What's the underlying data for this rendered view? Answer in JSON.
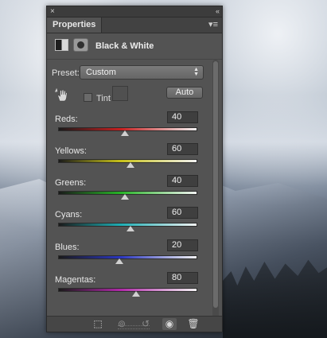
{
  "panel": {
    "title": "Properties",
    "close_glyph": "×",
    "collapse_glyph": "«",
    "menu_glyph": "▾≡",
    "header_title": "Black & White"
  },
  "preset": {
    "label": "Preset:",
    "value": "Custom",
    "arrows": "▲▼"
  },
  "tint": {
    "label": "Tint",
    "checked": false
  },
  "auto_label": "Auto",
  "sliders": [
    {
      "label": "Reds:",
      "value": "40",
      "min": -200,
      "max": 300,
      "position": 40
    },
    {
      "label": "Yellows:",
      "value": "60",
      "min": -200,
      "max": 300,
      "position": 60
    },
    {
      "label": "Greens:",
      "value": "40",
      "min": -200,
      "max": 300,
      "position": 40
    },
    {
      "label": "Cyans:",
      "value": "60",
      "min": -200,
      "max": 300,
      "position": 60
    },
    {
      "label": "Blues:",
      "value": "20",
      "min": -200,
      "max": 300,
      "position": 20
    },
    {
      "label": "Magentas:",
      "value": "80",
      "min": -200,
      "max": 300,
      "position": 80
    }
  ],
  "colors": {
    "reds": [
      "#1a1a1a",
      "#c62020",
      "#f2f2f2"
    ],
    "yellows": [
      "#1a1a1a",
      "#c8c21a",
      "#f2f2f2"
    ],
    "greens": [
      "#1a1a1a",
      "#27b427",
      "#f2f2f2"
    ],
    "cyans": [
      "#1a1a1a",
      "#1eaeb4",
      "#f2f2f2"
    ],
    "blues": [
      "#1a1a1a",
      "#2a36c0",
      "#f2f2f2"
    ],
    "magentas": [
      "#1a1a1a",
      "#b02aa8",
      "#f2f2f2"
    ]
  },
  "footer_icons": [
    "clip-to-layer-icon",
    "view-previous-state-icon",
    "reset-icon",
    "visibility-eye-icon",
    "trash-icon"
  ]
}
